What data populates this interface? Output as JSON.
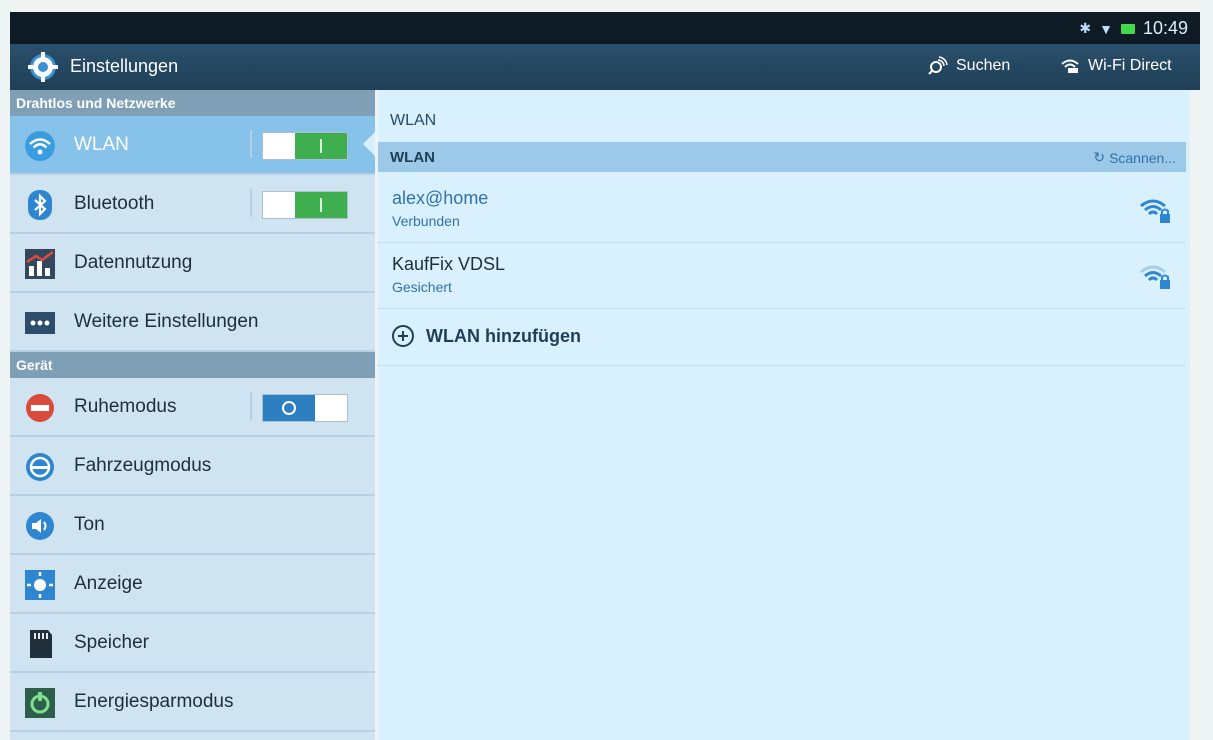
{
  "status_bar": {
    "time": "10:49",
    "icons": [
      "bluetooth-icon",
      "wifi-signal-icon",
      "battery-icon"
    ]
  },
  "action_bar": {
    "title": "Einstellungen",
    "app_icon": "settings-gear-icon",
    "actions": [
      {
        "label": "Suchen",
        "icon": "search-icon"
      },
      {
        "label": "Wi-Fi Direct",
        "icon": "wifi-direct-icon"
      }
    ]
  },
  "sidebar": {
    "sections": [
      {
        "header": "Drahtlos und Netzwerke",
        "items": [
          {
            "label": "WLAN",
            "icon": "wifi-icon",
            "toggle": "on",
            "selected": true
          },
          {
            "label": "Bluetooth",
            "icon": "bluetooth-icon",
            "toggle": "on"
          },
          {
            "label": "Datennutzung",
            "icon": "data-usage-icon"
          },
          {
            "label": "Weitere Einstellungen",
            "icon": "more-icon"
          }
        ]
      },
      {
        "header": "Gerät",
        "items": [
          {
            "label": "Ruhemodus",
            "icon": "do-not-disturb-icon",
            "toggle": "off"
          },
          {
            "label": "Fahrzeugmodus",
            "icon": "car-mode-icon"
          },
          {
            "label": "Ton",
            "icon": "sound-icon"
          },
          {
            "label": "Anzeige",
            "icon": "display-icon"
          },
          {
            "label": "Speicher",
            "icon": "storage-icon"
          },
          {
            "label": "Energiesparmodus",
            "icon": "power-saving-icon"
          }
        ]
      }
    ]
  },
  "main": {
    "title": "WLAN",
    "list_header": "WLAN",
    "scan_label": "Scannen...",
    "networks": [
      {
        "name": "alex@home",
        "state": "Verbunden",
        "signal": "strong-locked"
      },
      {
        "name": "KaufFix VDSL",
        "state": "Gesichert",
        "signal": "medium-locked"
      }
    ],
    "add_label": "WLAN hinzufügen"
  },
  "colors": {
    "accent": "#3fae4e",
    "selected": "#86c2ea",
    "header": "#7e9fb6"
  }
}
